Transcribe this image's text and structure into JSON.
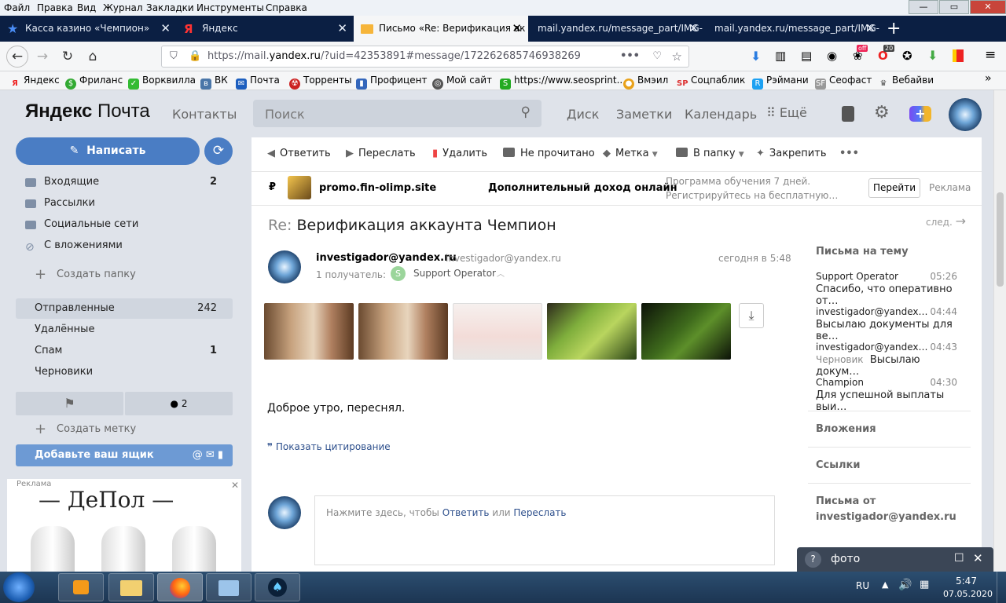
{
  "menubar": {
    "items": [
      "Файл",
      "Правка",
      "Вид",
      "Журнал",
      "Закладки",
      "Инструменты",
      "Справка"
    ]
  },
  "tabs": [
    {
      "title": "Касса казино «Чемпион»",
      "icon": "star-icon"
    },
    {
      "title": "Яндекс",
      "icon": "yandex-icon"
    },
    {
      "title": "Письмо «Re: Верификация ак",
      "icon": "mail-icon",
      "active": true
    },
    {
      "title": "mail.yandex.ru/message_part/IMG-",
      "icon": ""
    },
    {
      "title": "mail.yandex.ru/message_part/IMG-",
      "icon": ""
    }
  ],
  "urlbar": {
    "prefix": "https://mail.",
    "domain": "yandex.ru",
    "suffix": "/?uid=42353891#message/172262685746938269"
  },
  "ext_badges": {
    "off": "off",
    "count": "20"
  },
  "bookmarks": [
    "Яндекс",
    "Фриланс",
    "Ворквилла",
    "ВК",
    "Почта",
    "Торренты",
    "Профицент",
    "Мой сайт",
    "https://www.seosprint...",
    "Вмэил",
    "Соцпаблик",
    "Рэймани",
    "Сеофаст",
    "Вебайви"
  ],
  "header": {
    "logo_a": "Яндекс",
    "logo_b": "Почта",
    "contacts": "Контакты",
    "search_placeholder": "Поиск",
    "links": [
      "Диск",
      "Заметки",
      "Календарь"
    ],
    "more": "Ещё"
  },
  "sidebar": {
    "compose": "Написать",
    "folders": [
      {
        "label": "Входящие",
        "count": "2"
      },
      {
        "label": "Рассылки",
        "count": ""
      },
      {
        "label": "Социальные сети",
        "count": ""
      },
      {
        "label": "С вложениями",
        "count": ""
      }
    ],
    "create_folder": "Создать папку",
    "folders2": [
      {
        "label": "Отправленные",
        "count": "242"
      },
      {
        "label": "Удалённые",
        "count": ""
      },
      {
        "label": "Спам",
        "count": "1"
      },
      {
        "label": "Черновики",
        "count": ""
      }
    ],
    "flag_count": "2",
    "create_label": "Создать метку",
    "add_box": "Добавьте ваш ящик",
    "ad_label": "Реклама",
    "ad_brand": "— ДеПол —"
  },
  "toolbar": {
    "reply": "Ответить",
    "forward": "Переслать",
    "delete": "Удалить",
    "unread": "Не прочитано",
    "label": "Метка",
    "folder": "В папку",
    "pin": "Закрепить"
  },
  "adstrip": {
    "currency": "₽",
    "site": "promo.fin-olimp.site",
    "headline": "Дополнительный доход онлайн",
    "desc1": "Программа обучения 7 дней.",
    "desc2": "Регистрируйтесь на бесплатную…",
    "go": "Перейти",
    "ad": "Реклама"
  },
  "message": {
    "subject_prefix": "Re:",
    "subject": "Верификация аккаунта Чемпион",
    "next": "след.",
    "from_name": "investigador@yandex.ru",
    "from_email": "investigador@yandex.ru",
    "date": "сегодня в 5:48",
    "recipients_label": "1 получатель:",
    "recipient_initial": "S",
    "recipient": "Support Operator",
    "body": "Доброе утро, переснял.",
    "show_quote": "Показать цитирование",
    "reply_prompt_a": "Нажмите здесь, чтобы",
    "reply_link": "Ответить",
    "reply_or": "или",
    "forward_link": "Переслать"
  },
  "thread": {
    "title": "Письма на тему",
    "items": [
      {
        "from": "Support Operator",
        "time": "05:26",
        "snippet": "Спасибо, что оперативно от…",
        "tag": ""
      },
      {
        "from": "investigador@yandex…",
        "time": "04:44",
        "snippet": "Высылаю документы для ве…",
        "tag": ""
      },
      {
        "from": "investigador@yandex…",
        "time": "04:43",
        "snippet": "Высылаю докум…",
        "tag": "Черновик"
      },
      {
        "from": "Champion",
        "time": "04:30",
        "snippet": "Для успешной выплаты выи…",
        "tag": ""
      }
    ],
    "attachments": "Вложения",
    "links": "Ссылки",
    "letters_from": "Письма от",
    "letters_from_addr": "investigador@yandex.ru"
  },
  "search_popup": {
    "help": "?",
    "text": "фото"
  },
  "taskbar": {
    "lang": "RU",
    "time": "5:47",
    "date": "07.05.2020"
  },
  "colors": {
    "accent": "#4a7dc4",
    "tabbar": "#0b1f43",
    "active_folder": "#d0d6df"
  }
}
